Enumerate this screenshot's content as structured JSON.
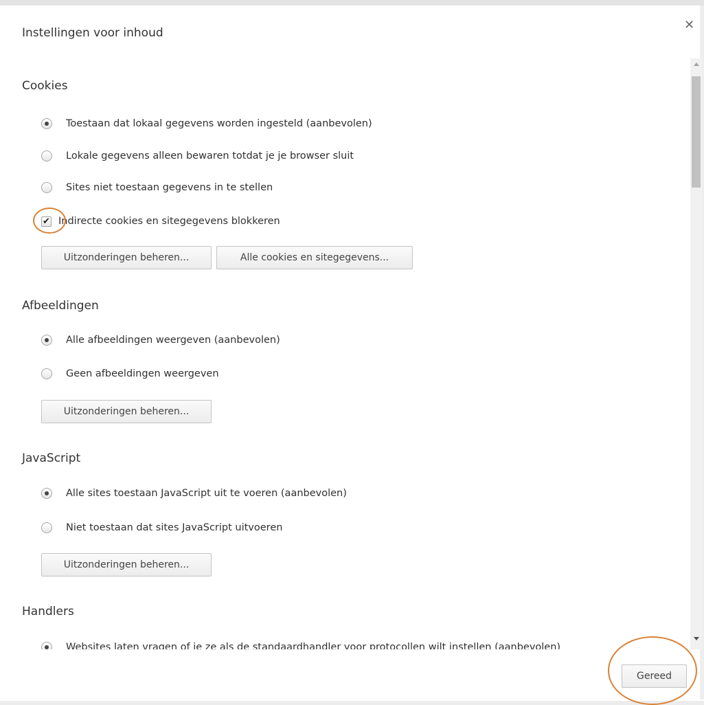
{
  "dialog": {
    "title": "Instellingen voor inhoud",
    "close_icon": "close-icon",
    "done_label": "Gereed"
  },
  "cookies": {
    "header": "Cookies",
    "options": [
      {
        "label": "Toestaan dat lokaal gegevens worden ingesteld (aanbevolen)",
        "checked": true
      },
      {
        "label": "Lokale gegevens alleen bewaren totdat je je browser sluit",
        "checked": false
      },
      {
        "label": "Sites niet toestaan gegevens in te stellen",
        "checked": false
      }
    ],
    "block_third_party": {
      "label": "Indirecte cookies en sitegegevens blokkeren",
      "checked": true
    },
    "manage_exceptions_label": "Uitzonderingen beheren...",
    "all_cookies_label": "Alle cookies en sitegegevens..."
  },
  "images": {
    "header": "Afbeeldingen",
    "options": [
      {
        "label": "Alle afbeeldingen weergeven (aanbevolen)",
        "checked": true
      },
      {
        "label": "Geen afbeeldingen weergeven",
        "checked": false
      }
    ],
    "manage_exceptions_label": "Uitzonderingen beheren..."
  },
  "javascript": {
    "header": "JavaScript",
    "options": [
      {
        "label": "Alle sites toestaan JavaScript uit te voeren (aanbevolen)",
        "checked": true
      },
      {
        "label": "Niet toestaan dat sites JavaScript uitvoeren",
        "checked": false
      }
    ],
    "manage_exceptions_label": "Uitzonderingen beheren..."
  },
  "handlers": {
    "header": "Handlers",
    "options": [
      {
        "label": "Websites laten vragen of je ze als de standaardhandler voor protocollen wilt instellen (aanbevolen)",
        "checked": true
      }
    ]
  },
  "colors": {
    "highlight": "#d98236",
    "scroll_thumb": "#c1c1c1"
  }
}
